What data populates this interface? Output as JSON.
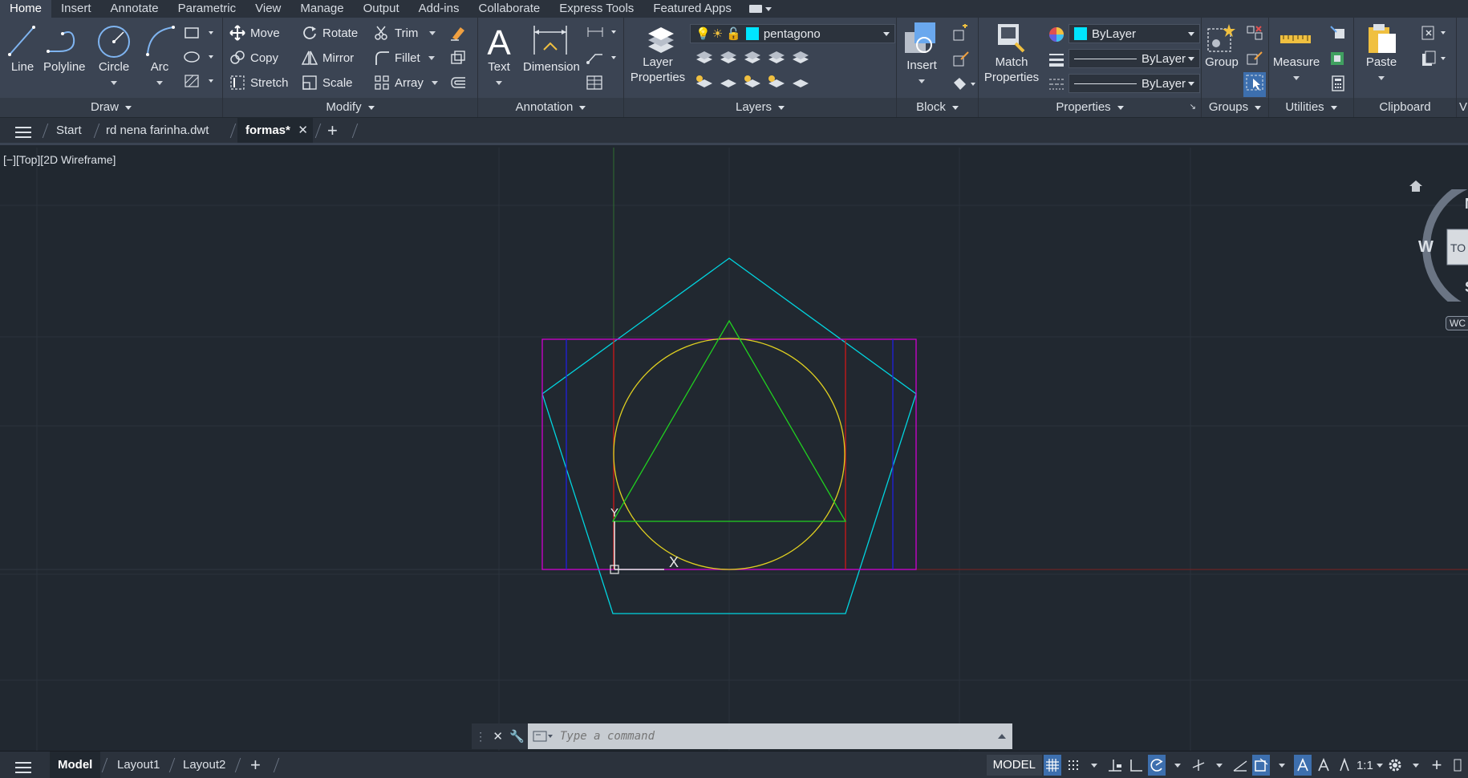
{
  "ribbon_tabs": [
    "Home",
    "Insert",
    "Annotate",
    "Parametric",
    "View",
    "Manage",
    "Output",
    "Add-ins",
    "Collaborate",
    "Express Tools",
    "Featured Apps"
  ],
  "active_tab": "Home",
  "panels": {
    "draw": {
      "title": "Draw",
      "line": "Line",
      "polyline": "Polyline",
      "circle": "Circle",
      "arc": "Arc"
    },
    "modify": {
      "title": "Modify",
      "move": "Move",
      "rotate": "Rotate",
      "trim": "Trim",
      "copy": "Copy",
      "mirror": "Mirror",
      "fillet": "Fillet",
      "stretch": "Stretch",
      "scale": "Scale",
      "array": "Array"
    },
    "annotation": {
      "title": "Annotation",
      "text": "Text",
      "dimension": "Dimension"
    },
    "layers": {
      "title": "Layers",
      "layer_properties_line1": "Layer",
      "layer_properties_line2": "Properties",
      "current_layer": "pentagono",
      "layer_color": "#00e5ff"
    },
    "block": {
      "title": "Block",
      "insert": "Insert"
    },
    "properties": {
      "title": "Properties",
      "match_line1": "Match",
      "match_line2": "Properties",
      "color": "ByLayer",
      "linetype": "ByLayer",
      "lineweight": "ByLayer"
    },
    "groups": {
      "title": "Groups",
      "group": "Group"
    },
    "utilities": {
      "title": "Utilities",
      "measure": "Measure"
    },
    "clipboard": {
      "title": "Clipboard",
      "paste": "Paste"
    },
    "view_cut": "V"
  },
  "file_tabs": {
    "start": "Start",
    "tabs": [
      "rd nena farinha.dwt",
      "formas*"
    ],
    "active": "formas*"
  },
  "viewport_label": "[−][Top][2D Wireframe]",
  "viewcube": {
    "west": "W",
    "north": "N",
    "south": "S",
    "face": "TO",
    "wcs": "WC"
  },
  "command": {
    "placeholder": "Type a command"
  },
  "drawing": {
    "pentagon_color": "#00d5e0",
    "rectangle_color": "#d000d0",
    "circle_color": "#e0d020",
    "triangle_color": "#20d020",
    "red_lines_color": "#d01818",
    "blue_lines_color": "#2020e0",
    "ucs_y": "Y",
    "ucs_x": "X"
  },
  "status": {
    "layouts": [
      "Model",
      "Layout1",
      "Layout2"
    ],
    "active_layout": "Model",
    "model_button": "MODEL",
    "scale": "1:1"
  }
}
